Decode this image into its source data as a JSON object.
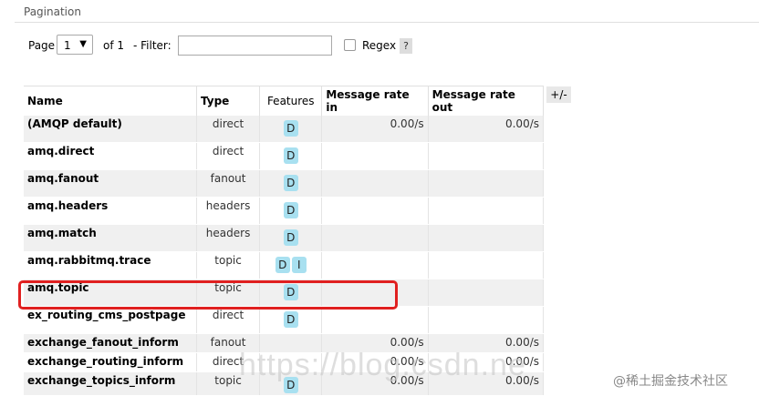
{
  "section": {
    "title": "Pagination"
  },
  "pager": {
    "page_label": "Page",
    "page_value": "1",
    "of_label": "of 1",
    "filter_label": "- Filter:",
    "filter_value": "",
    "regex_label": "Regex",
    "help_label": "?"
  },
  "table": {
    "headers": [
      "Name",
      "Type",
      "Features",
      "Message rate in",
      "Message rate out"
    ],
    "toggle_label": "+/-",
    "rows": [
      {
        "name": "(AMQP default)",
        "type": "direct",
        "features": [
          "D"
        ],
        "rate_in": "0.00/s",
        "rate_out": "0.00/s"
      },
      {
        "name": "amq.direct",
        "type": "direct",
        "features": [
          "D"
        ],
        "rate_in": "",
        "rate_out": ""
      },
      {
        "name": "amq.fanout",
        "type": "fanout",
        "features": [
          "D"
        ],
        "rate_in": "",
        "rate_out": ""
      },
      {
        "name": "amq.headers",
        "type": "headers",
        "features": [
          "D"
        ],
        "rate_in": "",
        "rate_out": ""
      },
      {
        "name": "amq.match",
        "type": "headers",
        "features": [
          "D"
        ],
        "rate_in": "",
        "rate_out": ""
      },
      {
        "name": "amq.rabbitmq.trace",
        "type": "topic",
        "features": [
          "D",
          "I"
        ],
        "rate_in": "",
        "rate_out": ""
      },
      {
        "name": "amq.topic",
        "type": "topic",
        "features": [
          "D"
        ],
        "rate_in": "",
        "rate_out": ""
      },
      {
        "name": "ex_routing_cms_postpage",
        "type": "direct",
        "features": [
          "D"
        ],
        "rate_in": "",
        "rate_out": ""
      },
      {
        "name": "exchange_fanout_inform",
        "type": "fanout",
        "features": [],
        "rate_in": "0.00/s",
        "rate_out": "0.00/s"
      },
      {
        "name": "exchange_routing_inform",
        "type": "direct",
        "features": [],
        "rate_in": "0.00/s",
        "rate_out": "0.00/s"
      },
      {
        "name": "exchange_topics_inform",
        "type": "topic",
        "features": [
          "D"
        ],
        "rate_in": "0.00/s",
        "rate_out": "0.00/s"
      }
    ]
  },
  "watermark": "https://blog.csdn.ne",
  "credit": "@稀土掘金技术社区",
  "colors": {
    "badge": "#a8e0f0",
    "highlight": "#e02020",
    "row_alt": "#f0f0f0"
  }
}
